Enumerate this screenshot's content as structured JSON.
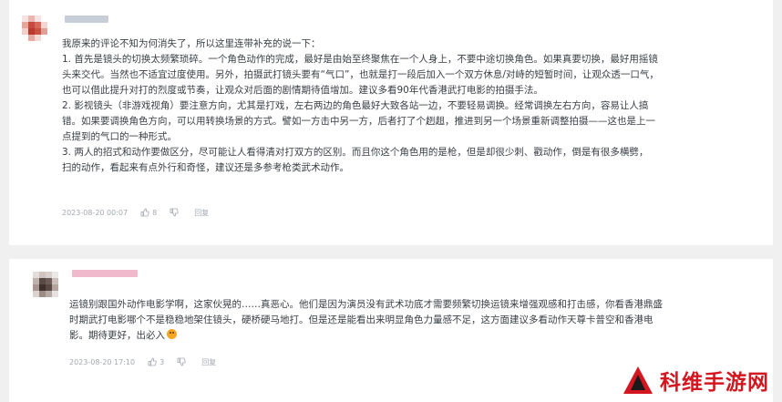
{
  "comments": [
    {
      "lines": [
        "我原来的评论不知为何消失了，所以这里连带补充的说一下：",
        "1. 首先是镜头的切换太频繁琐碎。一个角色动作的完成，最好是由始至终聚焦在一个人身上，不要中途切换角色。如果真要切换，最好用摇镜",
        "头来交代。当然也不适宜过度使用。另外，拍摄武打镜头要有“气口”，也就是打一段后加入一个双方休息/对峙的短暂时间，让观众透一口气，",
        "也可以借此提升对打的烈度或节奏，让观众对后面的剧情期待值增加。建议多看90年代香港武打电影的拍摄手法。",
        "2. 影视镜头（非游戏视角）要注意方向，尤其是打戏，左右两边的角色最好大致各站一边，不要轻易调换。经常调换左右方向，容易让人搞",
        "错。如果要调换角色方向，可以用转换场景的方式。譬如一方击中另一方，后者打了个趔趄，推进到另一个场景重新调整拍摄——这也是上一",
        "点提到的气口的一种形式。",
        "3. 两人的招式和动作要做区分，尽可能让人看得清对打双方的区别。而且你这个角色用的是枪，但是却很少刺、戳动作，倒是有很多横劈，",
        "扫的动作，看起来有点外行和奇怪，建议还是多参考枪类武术动作。"
      ],
      "date": "2023-08-20 00:07",
      "likes": "8",
      "reply_label": "回复"
    },
    {
      "lines": [
        "运镜别跟国外动作电影学啊，这家伙晃的……真恶心。他们是因为演员没有武术功底才需要频繁切换运镜来增强观感和打击感，你看香港鼎盛",
        "时期武打电影哪个不是稳稳地架住镜头，硬桥硬马地打。但是还是能看出来明显角色力量感不足，这方面建议多看动作天尊卡普空和香港电",
        "影。期待更好，出必入"
      ],
      "date": "2023-08-20 17:10",
      "likes": "3",
      "reply_label": "回复"
    }
  ],
  "watermark": {
    "text": "科维手游网",
    "color": "#d3161f"
  }
}
